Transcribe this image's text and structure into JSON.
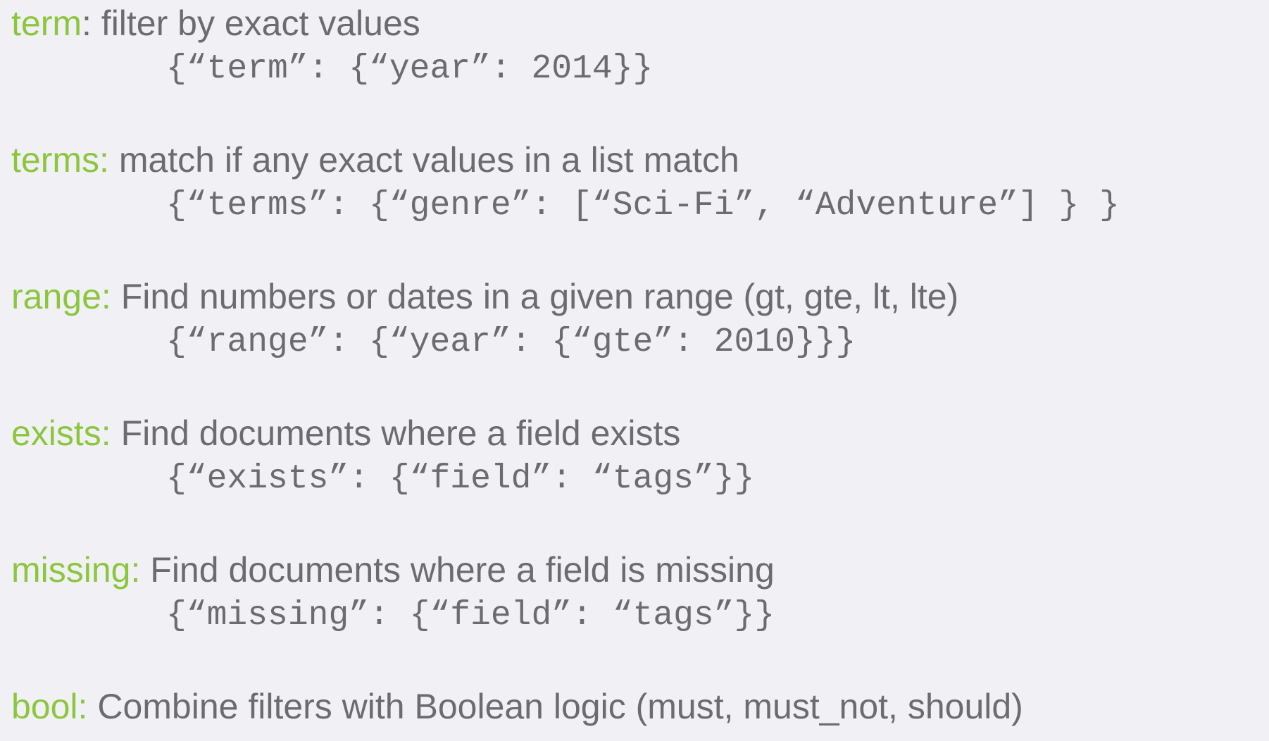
{
  "entries": [
    {
      "keyword": "term",
      "separator": ": ",
      "description": "filter by exact values",
      "code": "{“term”: {“year”: 2014}}"
    },
    {
      "keyword": "terms:",
      "separator": " ",
      "description": "match if any exact values in a list match",
      "code": "{“terms”: {“genre”: [“Sci-Fi”, “Adventure”] } }"
    },
    {
      "keyword": "range:",
      "separator": " ",
      "description": "Find numbers or dates in a given range (gt, gte, lt, lte)",
      "code": "{“range”: {“year”: {“gte”: 2010}}}"
    },
    {
      "keyword": "exists:",
      "separator": " ",
      "description": "Find documents where a field exists",
      "code": "{“exists”: {“field”: “tags”}}"
    },
    {
      "keyword": "missing:",
      "separator": " ",
      "description": "Find documents where a field is missing",
      "code": "{“missing”: {“field”: “tags”}}"
    },
    {
      "keyword": "bool:",
      "separator": " ",
      "description": "Combine filters with Boolean logic (must, must_not, should)",
      "code": ""
    }
  ],
  "colors": {
    "background": "#f1f1f5",
    "keyword": "#8cc63e",
    "text": "#6c6b70"
  }
}
